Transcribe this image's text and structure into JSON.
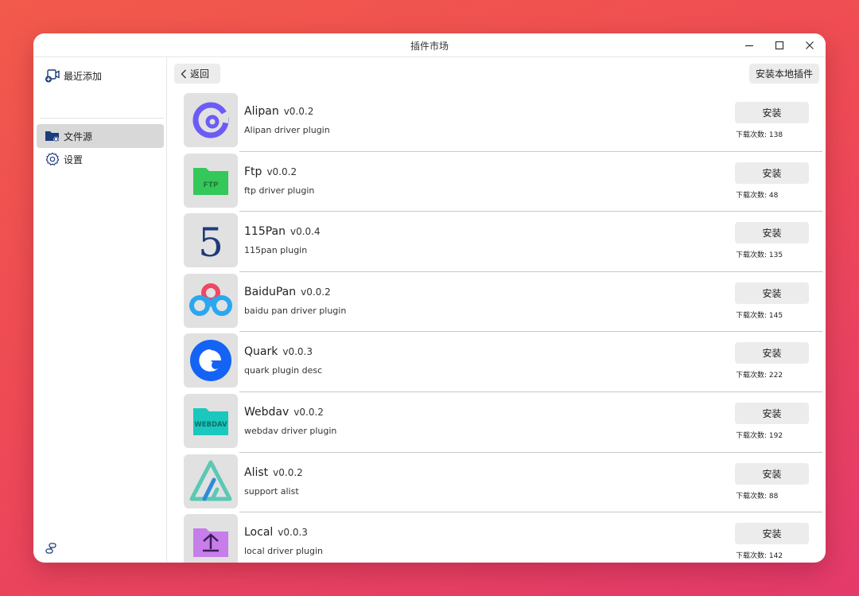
{
  "window": {
    "title": "插件市场"
  },
  "sidebar": {
    "items": [
      {
        "label": "最近添加",
        "icon": "video-add-icon"
      },
      {
        "label": "文件源",
        "icon": "folder-source-icon",
        "active": true
      },
      {
        "label": "设置",
        "icon": "gear-icon"
      }
    ],
    "bottom_icon": "link-icon"
  },
  "toolbar": {
    "back_label": "返回",
    "install_local_label": "安装本地插件"
  },
  "plugins": [
    {
      "name": "Alipan",
      "version": "v0.0.2",
      "description": "Alipan driver plugin",
      "install_label": "安装",
      "downloads": "下载次数: 138",
      "icon": "alipan-icon",
      "color": "#6b5cf6"
    },
    {
      "name": "Ftp",
      "version": "v0.0.2",
      "description": "ftp driver plugin",
      "install_label": "安装",
      "downloads": "下载次数: 48",
      "icon": "ftp-folder-icon",
      "color": "#34c759",
      "icon_text": "FTP"
    },
    {
      "name": "115Pan",
      "version": "v0.0.4",
      "description": "115pan plugin",
      "install_label": "安装",
      "downloads": "下载次数: 135",
      "icon": "115pan-icon",
      "color": "#1e3a7a",
      "icon_text": "5"
    },
    {
      "name": "BaiduPan",
      "version": "v0.0.2",
      "description": "baidu pan driver plugin",
      "install_label": "安装",
      "downloads": "下载次数: 145",
      "icon": "baidupan-icon",
      "color": "#2aa7f0"
    },
    {
      "name": "Quark",
      "version": "v0.0.3",
      "description": "quark plugin desc",
      "install_label": "安装",
      "downloads": "下载次数: 222",
      "icon": "quark-icon",
      "color": "#1463f5"
    },
    {
      "name": "Webdav",
      "version": "v0.0.2",
      "description": "webdav driver plugin",
      "install_label": "安装",
      "downloads": "下载次数: 192",
      "icon": "webdav-folder-icon",
      "color": "#1ac8bd",
      "icon_text": "WEBDAV"
    },
    {
      "name": "Alist",
      "version": "v0.0.2",
      "description": "support alist",
      "install_label": "安装",
      "downloads": "下载次数: 88",
      "icon": "alist-icon",
      "color": "#5bc8b4"
    },
    {
      "name": "Local",
      "version": "v0.0.3",
      "description": "local driver plugin",
      "install_label": "安装",
      "downloads": "下载次数: 142",
      "icon": "local-folder-icon",
      "color": "#c77dea"
    }
  ]
}
